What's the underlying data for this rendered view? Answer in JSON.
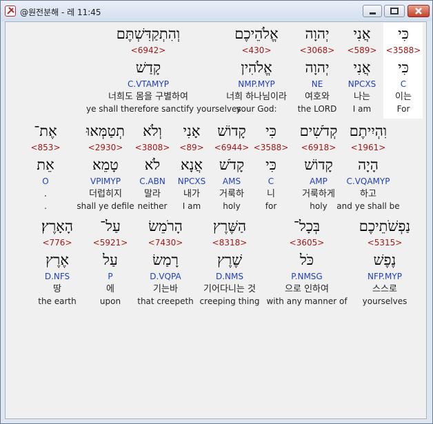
{
  "window": {
    "title": "@원전분해 - 레 11:45",
    "min_icon": "minimize-icon",
    "max_icon": "maximize-icon",
    "close_icon": "close-icon"
  },
  "rows": [
    {
      "words": [
        {
          "heb": "כִּי",
          "num": "<3588>",
          "lemma": "כִּי",
          "code": "C",
          "kor": "이는",
          "eng": "For"
        },
        {
          "heb": "אֲנִי",
          "num": "<589>",
          "lemma": "אֲנִי",
          "code": "NPCXS",
          "kor": "나는",
          "eng": "I am"
        },
        {
          "heb": "יְהוָה",
          "num": "<3068>",
          "lemma": "יְהוָה",
          "code": "NE",
          "kor": "여호와",
          "eng": "the LORD"
        },
        {
          "heb": "אֱלֹהֵיכֶם",
          "num": "<430>",
          "lemma": "אֱלֹהִין",
          "code": "NMP.MYP",
          "kor": "너희 하나님이라",
          "eng": "your God:"
        },
        {
          "heb": "וְהִתְקַדִּשְׁתֶּם",
          "num": "<6942>",
          "lemma": "קָדַשׁ",
          "code": "C.VTAMYP",
          "kor": "너희도 몸을 구별하여",
          "eng": "ye shall therefore sanctify yourselves"
        }
      ]
    },
    {
      "words": [
        {
          "heb": "וִהְיִיתֶם",
          "num": "<1961>",
          "lemma": "הָיָה",
          "code": "C.VQAMYP",
          "kor": "하고",
          "eng": "and ye shall be"
        },
        {
          "heb": "קְדֹשִׁים",
          "num": "<6918>",
          "lemma": "קָדוֹשׁ",
          "code": "AMP",
          "kor": "거룩하게",
          "eng": "holy"
        },
        {
          "heb": "כִּי",
          "num": "<3588>",
          "lemma": "כִּי",
          "code": "C",
          "kor": "니",
          "eng": "for"
        },
        {
          "heb": "קָדוֹשׁ",
          "num": "<6944>",
          "lemma": "קָדֹשׁ",
          "code": "AMS",
          "kor": "거룩하",
          "eng": "holy"
        },
        {
          "heb": "אָנִי",
          "num": "<89>",
          "lemma": "אֲנָא",
          "code": "NPCXS",
          "kor": "내가",
          "eng": "I am"
        },
        {
          "heb": "וְלֹא",
          "num": "<3808>",
          "lemma": "לֹא",
          "code": "C.ABN",
          "kor": "말라",
          "eng": "neither"
        },
        {
          "heb": "תְטַמְּאוּ",
          "num": "<2930>",
          "lemma": "טָמֵא",
          "code": "VPIMYP",
          "kor": "더럽히지",
          "eng": "shall ye defile"
        },
        {
          "heb": "אֶת־",
          "num": "<853>",
          "lemma": "אֵת",
          "code": "O",
          "kor": ".",
          "eng": "."
        }
      ]
    },
    {
      "words": [
        {
          "heb": "נַפְשֹׁתֵיכֶם",
          "num": "<5315>",
          "lemma": "נֶפֶשׁ",
          "code": "NFP.MYP",
          "kor": "스스로",
          "eng": "yourselves"
        },
        {
          "heb": "בְּכָל־",
          "num": "<3605>",
          "lemma": "כֹּל",
          "code": "P.NMSG",
          "kor": "으로 인하여",
          "eng": "with any manner of"
        },
        {
          "heb": "הַשֶּׁרֶץ",
          "num": "<8318>",
          "lemma": "שֶׁרֶץ",
          "code": "D.NMS",
          "kor": "기어다니는 것",
          "eng": "creeping thing"
        },
        {
          "heb": "הָרֹמֵשׂ",
          "num": "<7430>",
          "lemma": "רָמַשׂ",
          "code": "D.VQPA",
          "kor": "기는바",
          "eng": "that creepeth"
        },
        {
          "heb": "עַל־",
          "num": "<5921>",
          "lemma": "עַל",
          "code": "P",
          "kor": "에",
          "eng": "upon"
        },
        {
          "heb": "הָאָרֶץ׃",
          "num": "<776>",
          "lemma": "אֶרֶץ",
          "code": "D.NFS",
          "kor": "땅",
          "eng": "the earth"
        }
      ]
    }
  ]
}
